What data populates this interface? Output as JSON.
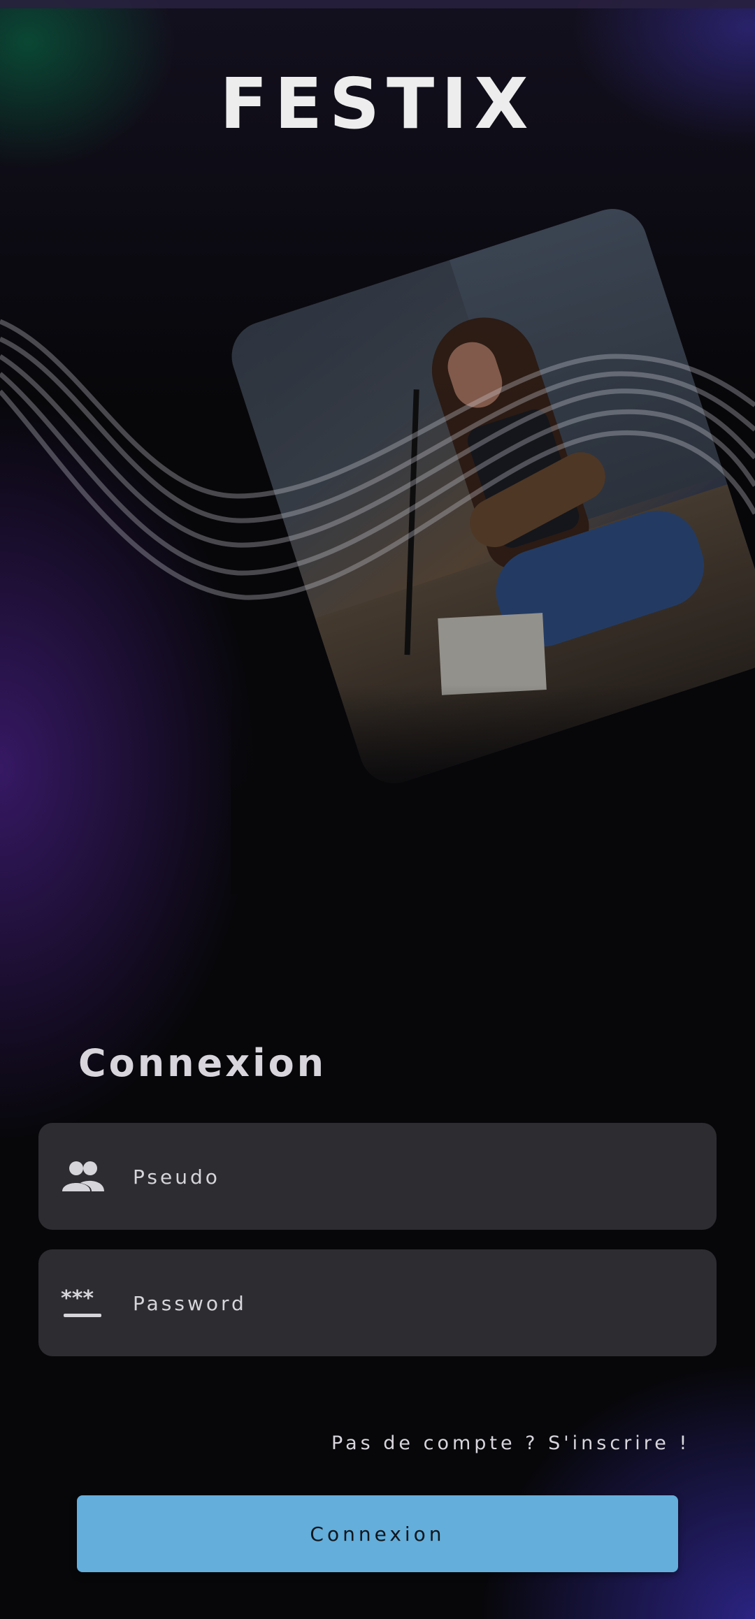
{
  "app": {
    "title": "FESTIX"
  },
  "login": {
    "heading": "Connexion",
    "username": {
      "placeholder": "Pseudo",
      "value": "",
      "icon": "people-icon"
    },
    "password": {
      "placeholder": "Password",
      "value": "",
      "icon": "password-icon"
    },
    "signup_link": "Pas de compte ? S'inscrire !",
    "submit_label": "Connexion"
  },
  "colors": {
    "accent": "#63aedb",
    "field_bg": "#2d2c31",
    "background": "#07070a",
    "glow_purple": "#3c1e6e",
    "glow_green": "#008c50"
  },
  "hero_image": {
    "icon": "concert-photo"
  }
}
